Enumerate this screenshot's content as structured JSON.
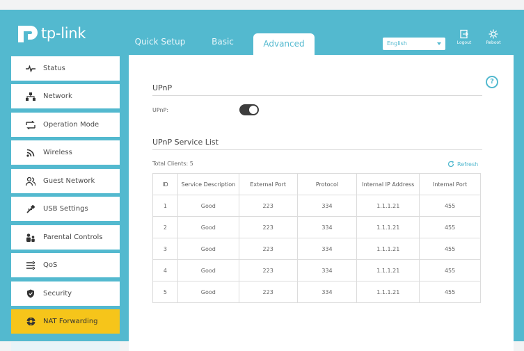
{
  "header": {
    "brand": "tp-link",
    "tabs": [
      {
        "label": "Quick Setup"
      },
      {
        "label": "Basic"
      },
      {
        "label": "Advanced"
      }
    ],
    "language": "English",
    "logout_label": "Logout",
    "reboot_label": "Reboot"
  },
  "sidebar": {
    "items": [
      {
        "label": "Status",
        "icon": "pulse-icon"
      },
      {
        "label": "Network",
        "icon": "network-icon"
      },
      {
        "label": "Operation Mode",
        "icon": "operation-mode-icon"
      },
      {
        "label": "Wireless",
        "icon": "wifi-icon"
      },
      {
        "label": "Guest Network",
        "icon": "guest-users-icon"
      },
      {
        "label": "USB Settings",
        "icon": "usb-icon"
      },
      {
        "label": "Parental Controls",
        "icon": "parental-icon"
      },
      {
        "label": "QoS",
        "icon": "qos-icon"
      },
      {
        "label": "Security",
        "icon": "shield-icon"
      },
      {
        "label": "NAT Forwarding",
        "icon": "nat-icon"
      }
    ],
    "active": "NAT Forwarding"
  },
  "main": {
    "upnp_title": "UPnP",
    "upnp_label": "UPnP:",
    "upnp_enabled": true,
    "service_list_title": "UPnP Service List",
    "total_clients_label": "Total Clients: 5",
    "refresh_label": "Refresh",
    "table": {
      "headers": [
        "ID",
        "Service Description",
        "External Port",
        "Protocol",
        "Internal IP Address",
        "Internal Port"
      ],
      "rows": [
        [
          "1",
          "Good",
          "223",
          "334",
          "1.1.1.21",
          "455"
        ],
        [
          "2",
          "Good",
          "223",
          "334",
          "1.1.1.21",
          "455"
        ],
        [
          "3",
          "Good",
          "223",
          "334",
          "1.1.1.21",
          "455"
        ],
        [
          "4",
          "Good",
          "223",
          "334",
          "1.1.1.21",
          "455"
        ],
        [
          "5",
          "Good",
          "223",
          "334",
          "1.1.1.21",
          "455"
        ]
      ]
    }
  },
  "colors": {
    "accent": "#53b9cf",
    "active_nav": "#f6c51a"
  }
}
